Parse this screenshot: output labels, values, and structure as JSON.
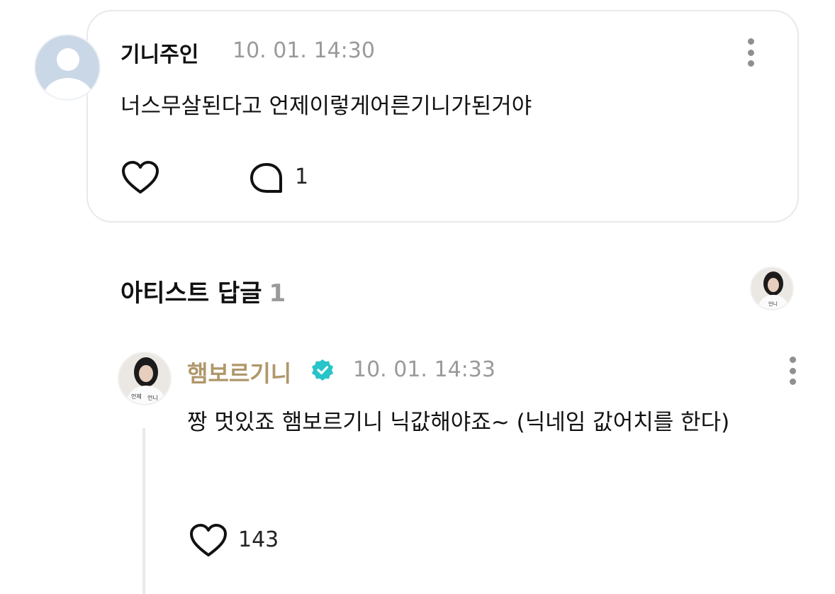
{
  "comment": {
    "username": "기니주인",
    "timestamp": "10. 01. 14:30",
    "text": "너스무살된다고 언제이렇게어른기니가된거야",
    "reply_count": "1"
  },
  "artist_replies": {
    "title": "아티스트 답글",
    "count": "1"
  },
  "reply": {
    "username": "햄보르기니",
    "timestamp": "10. 01. 14:33",
    "text": "짱 멋있죠 햄보르기니 닉값해야죠~ (닉네임 값어치를 한다)",
    "like_count": "143"
  },
  "colors": {
    "artist_name": "#b0976a",
    "verified_badge": "#27c4c9",
    "meta_gray": "#9a9a9a",
    "card_border": "#e9e9ec"
  },
  "icons": [
    "more-vertical-icon",
    "heart-icon",
    "comment-bubble-icon",
    "verified-badge-icon",
    "default-avatar-icon"
  ]
}
